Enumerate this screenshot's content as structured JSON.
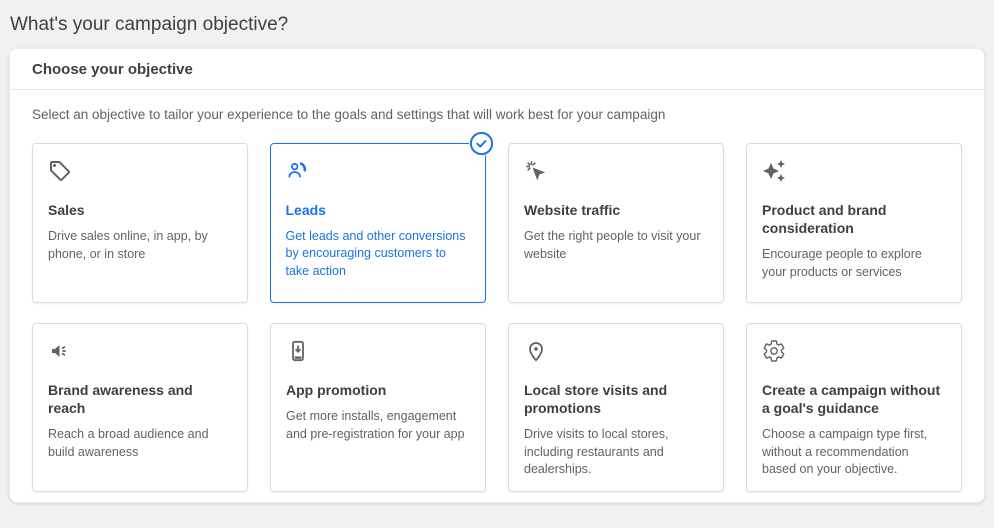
{
  "page": {
    "title": "What's your campaign objective?"
  },
  "panel": {
    "header": "Choose your objective",
    "subtitle": "Select an objective to tailor your experience to the goals and settings that will work best for your campaign"
  },
  "colors": {
    "accent_blue": "#1a73e8",
    "icon_gray": "#5f6368",
    "title_text": "#3c4043",
    "body_text": "#5f6368",
    "card_border": "#dadce0",
    "page_background": "#f1f1f1"
  },
  "objectives": [
    {
      "id": "sales",
      "icon": "price-tag-icon",
      "title": "Sales",
      "description": "Drive sales online, in app, by phone, or in store",
      "selected": false
    },
    {
      "id": "leads",
      "icon": "person-lead-icon",
      "title": "Leads",
      "description": "Get leads and other conversions by encouraging customers to take action",
      "selected": true
    },
    {
      "id": "website-traffic",
      "icon": "cursor-click-icon",
      "title": "Website traffic",
      "description": "Get the right people to visit your website",
      "selected": false
    },
    {
      "id": "product-and-brand-consideration",
      "icon": "sparkles-icon",
      "title": "Product and brand consideration",
      "description": "Encourage people to explore your products or services",
      "selected": false
    },
    {
      "id": "brand-awareness-and-reach",
      "icon": "megaphone-icon",
      "title": "Brand awareness and reach",
      "description": "Reach a broad audience and build awareness",
      "selected": false
    },
    {
      "id": "app-promotion",
      "icon": "phone-download-icon",
      "title": "App promotion",
      "description": "Get more installs, engagement and pre-registration for your app",
      "selected": false
    },
    {
      "id": "local-store-visits-and-promotions",
      "icon": "location-pin-icon",
      "title": "Local store visits and promotions",
      "description": "Drive visits to local stores, including restaurants and dealerships.",
      "selected": false
    },
    {
      "id": "no-goal-guidance",
      "icon": "gear-icon",
      "title": "Create a campaign without a goal's guidance",
      "description": "Choose a campaign type first, without a recommendation based on your objective.",
      "selected": false
    }
  ]
}
